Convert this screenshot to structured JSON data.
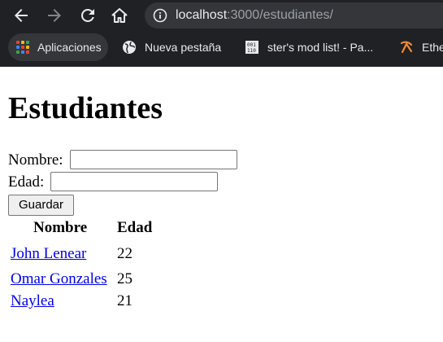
{
  "browser": {
    "url_host": "localhost",
    "url_rest": ":3000/estudiantes/",
    "bookmarks": [
      {
        "label": "Aplicaciones",
        "icon": "apps-grid-icon"
      },
      {
        "label": "Nueva pestaña",
        "icon": "globe-icon"
      },
      {
        "label": "ster's mod list! - Pa...",
        "icon": "binary-doc-icon"
      },
      {
        "label": "Ethe",
        "icon": "pickaxe-icon"
      }
    ],
    "colors": {
      "chrome_bg": "#202124",
      "omnibox_bg": "#35363a",
      "text": "#e8eaed",
      "dim_text": "#9aa0a6",
      "pickaxe": "#f28b30"
    }
  },
  "page": {
    "title": "Estudiantes",
    "form": {
      "nombre_label": "Nombre:",
      "nombre_value": "",
      "edad_label": "Edad:",
      "edad_value": "",
      "save_label": "Guardar"
    },
    "table": {
      "headers": [
        "Nombre",
        "Edad"
      ],
      "rows": [
        {
          "nombre": "John Lenear",
          "edad": "22"
        },
        {
          "nombre": "Omar Gonzales",
          "edad": "25"
        },
        {
          "nombre": "Naylea",
          "edad": "21"
        }
      ]
    },
    "colors": {
      "link": "#0000ee",
      "text": "#000000"
    }
  }
}
